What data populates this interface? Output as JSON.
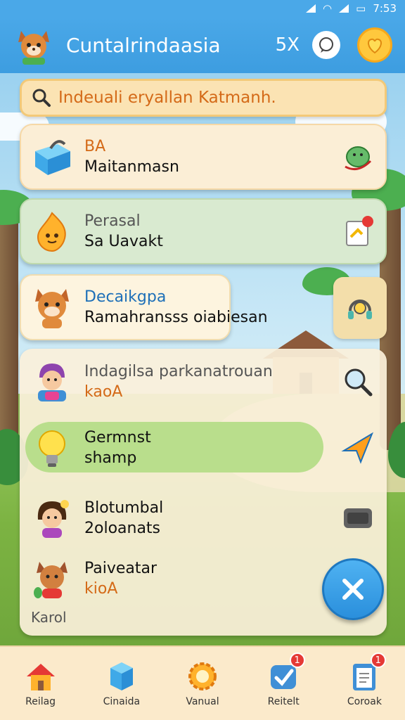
{
  "status": {
    "time": "7:53"
  },
  "header": {
    "title": "Cuntalrindaasia",
    "count": "5X"
  },
  "search": {
    "text": "Indeuali eryallan Katmanh."
  },
  "items": [
    {
      "line1": "BA",
      "line2": "Maitanmasn",
      "icon": "blue-box-icon",
      "right_icon": "green-alien-icon"
    },
    {
      "line1": "Perasal",
      "line2": "Sa Uavakt",
      "icon": "orange-flame-icon",
      "right_icon": "sticker-note-icon"
    },
    {
      "line1": "Decaikgpa",
      "line2": "Ramahransss oiabiesan",
      "icon": "cat-mascot-icon",
      "right_icon": "headphone-icon"
    },
    {
      "line1": "Indagilsa parkanatrouan",
      "line2": "kaoA",
      "icon": "kid-avatar-icon",
      "right_icon": "magnifier-icon"
    },
    {
      "line1": "Germnst",
      "line2": "shamp",
      "icon": "lightbulb-icon",
      "right_icon": "paper-plane-icon"
    },
    {
      "line1": "Blotumbal",
      "line2": "2oloanats",
      "icon": "girl-avatar-icon",
      "right_icon": "keyboard-icon"
    },
    {
      "line1": "Paiveatar",
      "line2": "kioA",
      "icon": "fox-avatar-icon",
      "right_icon": ""
    }
  ],
  "footer_label": "Karol",
  "nav": [
    {
      "label": "Reilag",
      "icon": "home-icon",
      "badge": ""
    },
    {
      "label": "Cinaida",
      "icon": "cube-icon",
      "badge": ""
    },
    {
      "label": "Vanual",
      "icon": "gear-badge-icon",
      "badge": ""
    },
    {
      "label": "Reitelt",
      "icon": "check-shield-icon",
      "badge": "1"
    },
    {
      "label": "Coroak",
      "icon": "clipboard-icon",
      "badge": "1"
    }
  ],
  "colors": {
    "appbar": "#3d9de0",
    "accent": "#d46a18",
    "highlight": "#b9de8c"
  }
}
